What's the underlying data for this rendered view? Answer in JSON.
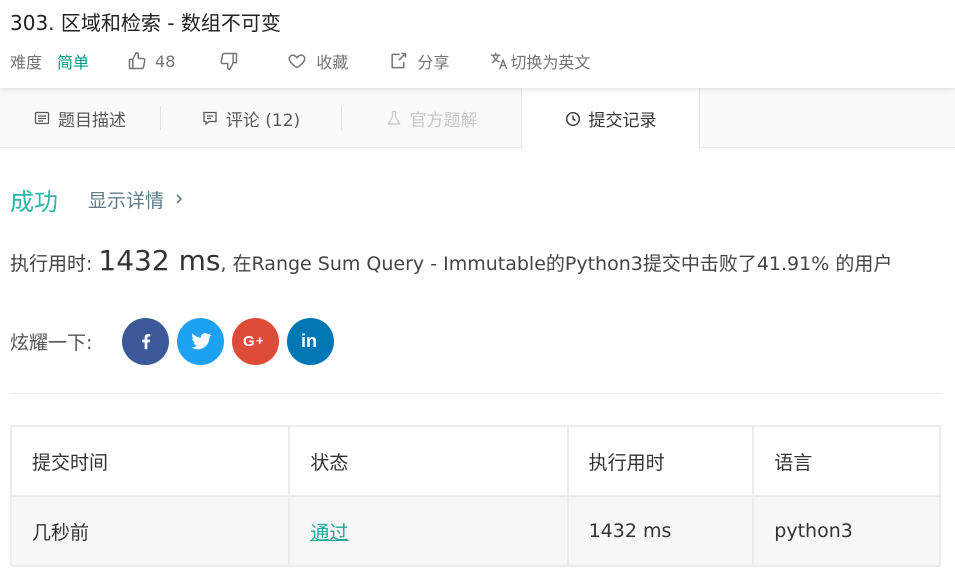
{
  "header": {
    "title": "303. 区域和检索 - 数组不可变",
    "difficulty_label": "难度",
    "difficulty": "简单",
    "like_count": "48",
    "favorite_label": "收藏",
    "share_label": "分享",
    "translate_label": "切换为英文",
    "icons": [
      "thumbs-up-icon",
      "thumbs-down-icon",
      "heart-icon",
      "share-icon",
      "translate-icon"
    ]
  },
  "tabs": [
    {
      "label": "题目描述",
      "icon": "description-icon",
      "state": "normal"
    },
    {
      "label": "评论 (12)",
      "icon": "comment-icon",
      "state": "normal"
    },
    {
      "label": "官方题解",
      "icon": "flask-icon",
      "state": "disabled"
    },
    {
      "label": "提交记录",
      "icon": "clock-icon",
      "state": "active"
    }
  ],
  "result": {
    "status": "成功",
    "details_link": "显示详情"
  },
  "runtime": {
    "prefix": "执行用时: ",
    "value": "1432 ms",
    "suffix": ", 在Range Sum Query - Immutable的Python3提交中击败了41.91% 的用户"
  },
  "share": {
    "label": "炫耀一下:",
    "networks": [
      {
        "name": "facebook",
        "color": "#3b5998"
      },
      {
        "name": "twitter",
        "color": "#1da1f2"
      },
      {
        "name": "google-plus",
        "color": "#dd4b39"
      },
      {
        "name": "linkedin",
        "color": "#0077b5"
      }
    ]
  },
  "table": {
    "headers": [
      "提交时间",
      "状态",
      "执行用时",
      "语言"
    ],
    "rows": [
      [
        "几秒前",
        "通过",
        "1432 ms",
        "python3"
      ]
    ]
  },
  "colors": {
    "accent": "#009688",
    "success": "#2db7a6"
  }
}
